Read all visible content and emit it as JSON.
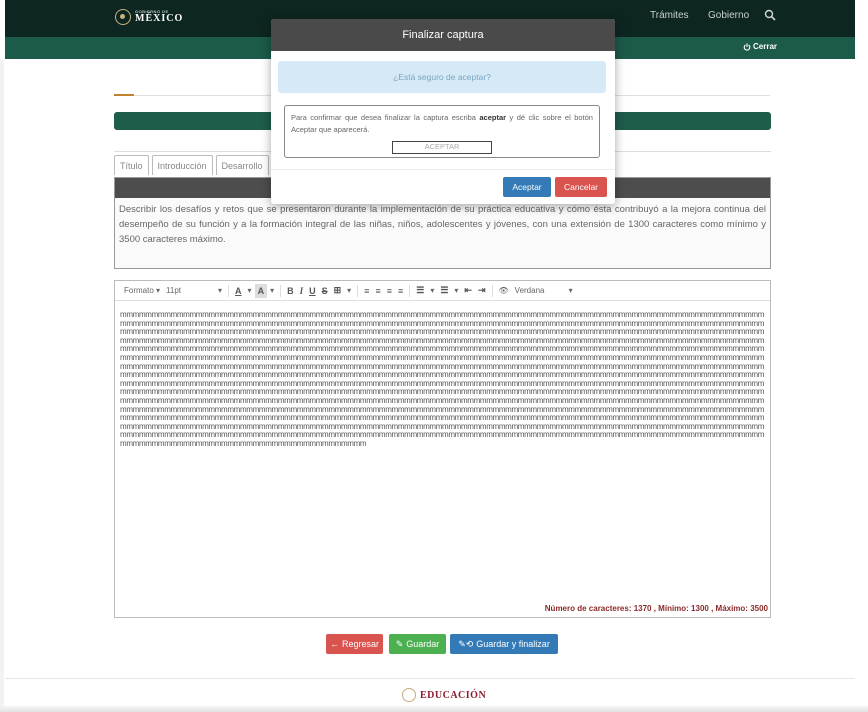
{
  "header": {
    "logo_small": "GOBIERNO DE",
    "logo_big": "MÉXICO",
    "nav": [
      "Trámites",
      "Gobierno"
    ],
    "logout_label": "Cerrar"
  },
  "tabs": [
    "Título",
    "Introducción",
    "Desarrollo"
  ],
  "prompt_text": "Describir los desafíos y retos que se presentaron durante la implementación de su práctica educativa y cómo ésta contribuyó a la mejora continua del desempeño de su función y a la formación integral de las niñas, niños, adolescentes y jóvenes, con una extensión de 1300 caracteres como mínimo y 3500 caracteres máximo.",
  "toolbar": {
    "format_label": "Formato",
    "size_label": "11pt",
    "font_label": "Verdana"
  },
  "editor": {
    "content": "mmmmmmmmmmmmmmmmmmmmmmmmmmmmmmmmmmmmmmmmmmmmmmmmmmmmmmmmmmmmmmmmmmmmmmmmmmmmmmmmmmmmmmmmmmmmmmmmmmmmmmmmmmmmmmmmmmmmmmmmmmmmmmmmmmmmmmmmmmmmmmmmmmmmmmmmmmmmmmmmmmmmmmmmmmmmmmmmmmmmmmmmmmmmmmmmmmmmmmmmmmmmmmmmmmmmmmmmmmmmmmmmmmmmmmmmmmmmmmmmmmmmmmmmmmmmmmmmmmmmmmmmmmmmmmmmmmmmmmmmmmmmmmmmmmmmmmmmmmmmmmmmmmmmmmmmmmmmmmmmmmmmmmmmmmmmmmmmmmmmmmmmmmmmmmmmmmmmmmmmmmmmmmmmmmmmmmmmmmmmmmmmmmmmmmmmmmmmmmmmmmmmmmmmmmmmmmmmmmmmmmmmmmmmmmmmmmmmmmmmmmmmmmmmmmmmmmmmmmmmmmmmmmmmmmmmmmmmmmmmmmmmmmmmmmmmmmmmmmmmmmmmmmmmmmmmmmmmmmmmmmmmmmmmmmmmmmmmmmmmmmmmmmmmmmmmmmmmmmmmmmmmmmmmmmmmmmmmmmmmmmmmmmmmmmmmmmmmmmmmmmmmmmmmmmmmmmmmmmmmmmmmmmmmmmmmmmmmmmmmmmmmmmmmmmmmmmmmmmmmmmmmmmmmmmmmmmmmmmmmmmmmmmmmmmmmmmmmmmmmmmmmmmmmmmmmmmmmmmmmmmmmmmmmmmmmmmmmmmmmmmmmmmmmmmmmmmmmmmmmmmmmmmmmmmmmmmmmmmmmmmmmmmmmmmmmmmmmmmmmmmmmmmmmmmmmmmmmmmmmmmmmmmmmmmmmmmmmmmmmmmmmmmmmmmmmmmmmmmmmmmmmmmmmmmmmmmmmmmmmmmmmmmmmmmmmmmmmmmmmmmmmmmmmmmmmmmmmmmmmmmmmmmmmmmmmmmmmmmmmmmmmmmmmmmmmmmmmmmmmmmmmmmmmmmmmmmmmmmmmmmmmmmmmmmmmmmmmmmmmmmmmmmmmmmmmmmmmmmmmmmmmmmmmmmmmmmmmmmmmmmmmmmmmmmmmmmmmmmmmmmmmmmmmmmmmmmmmmmmmmmmmmmmmmmmmmmmmmmmmmmmmmmmmmmmmmmmmmmmmmmmmmmmmmmmmmmmmmmmmmmmmmmmmmmmmmmmmmmmmmmmmmmmmmmmmmmmmmmmmmmmmmmmmmmmmmmmmmmmmmmmmmmmmmmmmmmmmmmmmmmmmmmmmmmmmmmmmmmmmmmmmmmmmmmmmmmmmmmmmmmmmmmmmmmmmmmmmmmmmmmmmmmmmmmmmmmmmmmmmmmmmmmmmmmmmmmmmmmmmmmmmmmmmmmmmmmmmmmmmmmmmmmmmmmmmmmmmmmmmmmmmmmmmmmmmmmmmmmmmmmmmmmmmmmmmmmmmmmmmmmmmmmmmmmmmmmmmmmmmmmmmmmmmmmmmmmmmmmmmmmmmmmmmmmmmmmmmmmmmmmmmmmmmmmmmmmmmmmmmmmmmmmmmmmmmmmmmmmmmmmmmmmmmmmmmmmmmmmmmmmmmmmmmmmmmmmmmmmmmmmmmmmmmmmmmmmmmmmmmmmmmmmmmm",
    "counter": "Número de caracteres: 1370 , Mínimo: 1300 , Máximo: 3500"
  },
  "actions": {
    "back": "Regresar",
    "save": "Guardar",
    "finalize": "Guardar y finalizar"
  },
  "footer": {
    "logo_text": "EDUCACIÓN"
  },
  "modal": {
    "title": "Finalizar captura",
    "alert": "¿Está seguro de aceptar?",
    "confirm_text_before": "Para confirmar que desea finalizar la captura escriba",
    "confirm_keyword": "aceptar",
    "confirm_text_after": "y dé clic sobre el botón Aceptar que aparecerá.",
    "input_value": "ACEPTAR",
    "accept": "Aceptar",
    "cancel": "Cancelar"
  },
  "colors": {
    "header_dark": "#0d2621",
    "header_green": "#1c5a4a",
    "primary": "#337ab7",
    "danger": "#d9534f",
    "success": "#4caf50"
  }
}
